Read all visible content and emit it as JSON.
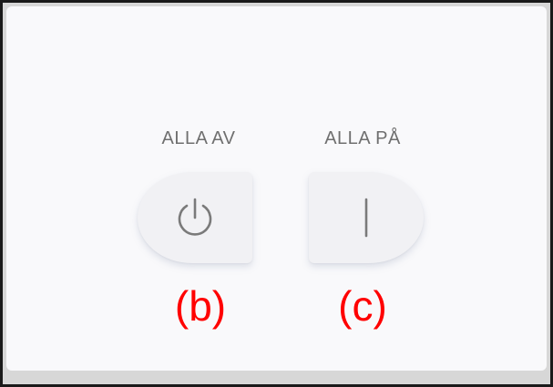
{
  "controls": {
    "all_off": {
      "label": "ALLA AV",
      "icon": "power-icon",
      "annotation": "(b)"
    },
    "all_on": {
      "label": "ALLA PÅ",
      "icon": "on-bar-icon",
      "annotation": "(c)"
    }
  },
  "colors": {
    "label_text": "#6f6f6f",
    "annotation_text": "#ff0000",
    "button_bg": "#f1f1f4",
    "panel_bg": "#f9f9fb",
    "icon": "#7a7a7a"
  }
}
